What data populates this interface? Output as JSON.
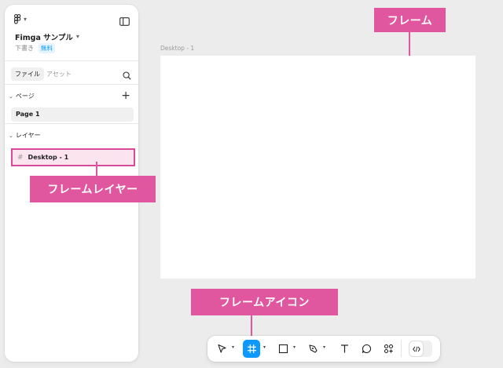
{
  "sidebar": {
    "logo_icon": "figma-logo-icon",
    "panel_toggle_icon": "sidebar-panel-icon",
    "file_name": "Fimga サンプル",
    "file_status": "下書き",
    "plan_badge": "無料",
    "tabs": [
      {
        "label": "ファイル",
        "active": true
      },
      {
        "label": "アセット",
        "active": false
      }
    ],
    "pages_header": "ページ",
    "pages": [
      {
        "label": "Page 1",
        "selected": true
      }
    ],
    "layers_header": "レイヤー",
    "layers": [
      {
        "label": "Desktop - 1",
        "icon": "frame-hash-icon",
        "highlighted": true
      }
    ]
  },
  "canvas": {
    "frame_label": "Desktop - 1",
    "frame_fill": "#ffffff",
    "background": "#ececec"
  },
  "annotations": {
    "frame": "フレーム",
    "frame_layer": "フレームレイヤー",
    "frame_icon": "フレームアイコン",
    "color": "#e0579f"
  },
  "toolbar": {
    "tools": [
      {
        "name": "move-tool",
        "icon": "cursor-arrow-icon",
        "has_menu": true
      },
      {
        "name": "frame-tool",
        "icon": "frame-hash-icon",
        "has_menu": true,
        "active": true
      },
      {
        "name": "shape-tool",
        "icon": "rectangle-icon",
        "has_menu": true
      },
      {
        "name": "pen-tool",
        "icon": "pen-nib-icon",
        "has_menu": true
      },
      {
        "name": "text-tool",
        "icon": "text-t-icon",
        "has_menu": false
      },
      {
        "name": "comment-tool",
        "icon": "comment-bubble-icon",
        "has_menu": false
      },
      {
        "name": "actions-tool",
        "icon": "components-plus-icon",
        "has_menu": false
      }
    ],
    "dev_mode_icon": "code-brackets-icon",
    "active_color": "#0d99ff"
  }
}
